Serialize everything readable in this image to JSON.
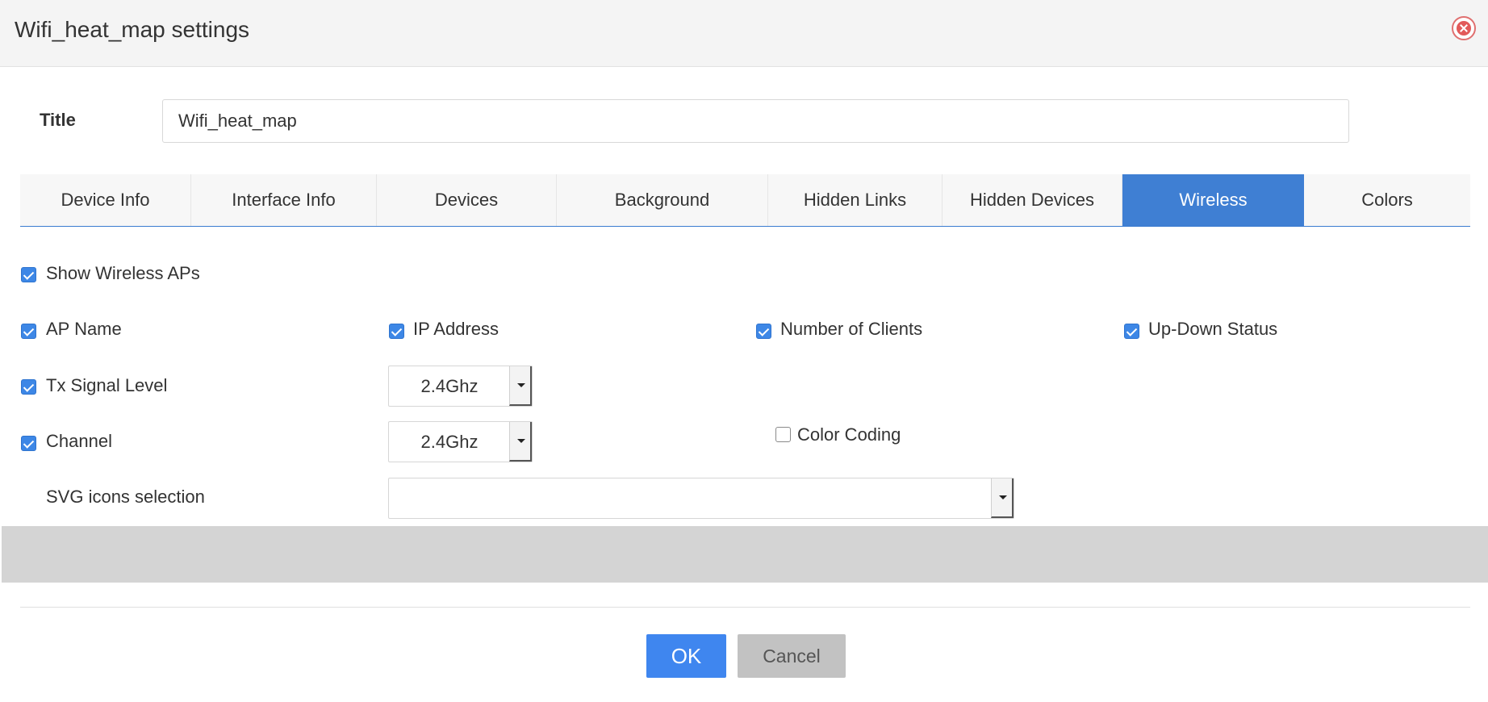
{
  "dialog": {
    "title": "Wifi_heat_map settings",
    "close_icon": "close-icon"
  },
  "title_field": {
    "label": "Title",
    "value": "Wifi_heat_map"
  },
  "tabs": [
    {
      "label": "Device Info",
      "active": false
    },
    {
      "label": "Interface Info",
      "active": false
    },
    {
      "label": "Devices",
      "active": false
    },
    {
      "label": "Background",
      "active": false
    },
    {
      "label": "Hidden Links",
      "active": false
    },
    {
      "label": "Hidden Devices",
      "active": false
    },
    {
      "label": "Wireless",
      "active": true
    },
    {
      "label": "Colors",
      "active": false
    }
  ],
  "wireless": {
    "show_wireless_aps": {
      "label": "Show Wireless APs",
      "checked": true
    },
    "ap_name": {
      "label": "AP Name",
      "checked": true
    },
    "ip_address": {
      "label": "IP Address",
      "checked": true
    },
    "number_of_clients": {
      "label": "Number of Clients",
      "checked": true
    },
    "up_down_status": {
      "label": "Up-Down Status",
      "checked": true
    },
    "tx_signal_level": {
      "label": "Tx Signal Level",
      "checked": true,
      "band": "2.4Ghz"
    },
    "channel": {
      "label": "Channel",
      "checked": true,
      "band": "2.4Ghz"
    },
    "color_coding": {
      "label": "Color Coding",
      "checked": false
    },
    "svg_icons_selection": {
      "label": "SVG icons selection",
      "value": ""
    }
  },
  "footer": {
    "ok_label": "OK",
    "cancel_label": "Cancel"
  },
  "colors": {
    "accent": "#3f7fd3",
    "ok_button": "#3f86ef",
    "cancel_button": "#c2c2c2",
    "checkbox_checked": "#3d87e6",
    "header_bg": "#f4f4f4"
  }
}
